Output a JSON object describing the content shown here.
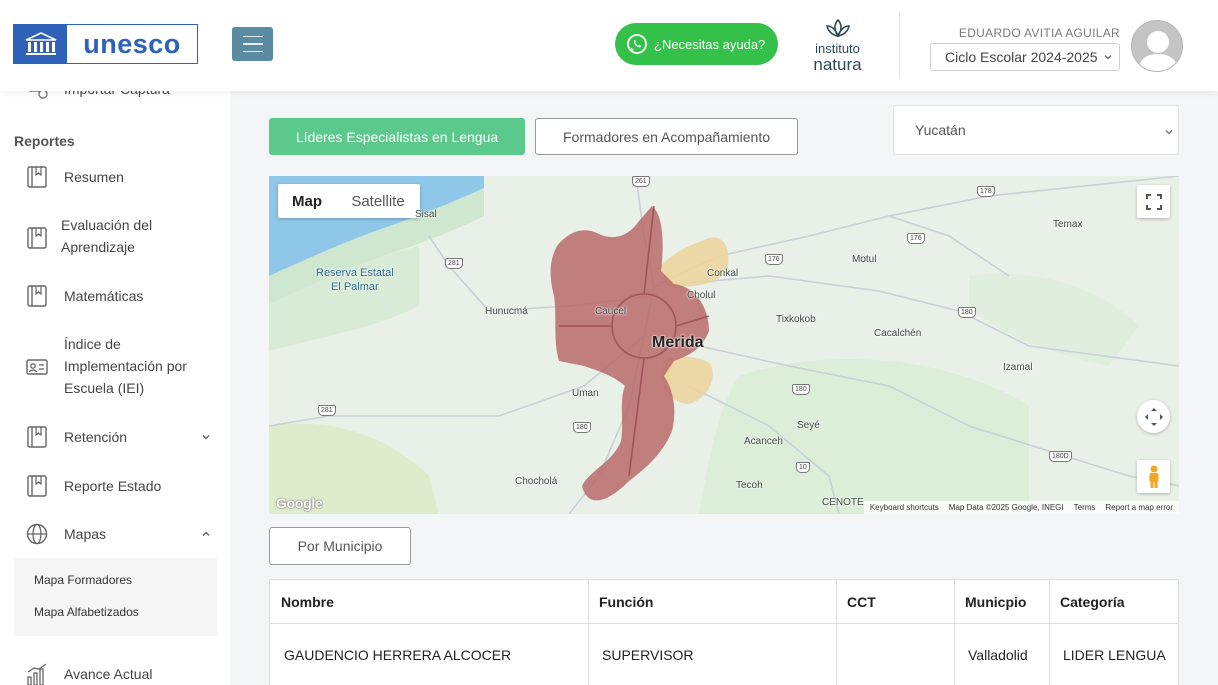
{
  "header": {
    "logo_text": "unesco",
    "help_label": "¿Necesitas ayuda?",
    "partner_line1": "instituto",
    "partner_line2": "natura",
    "user_name": "EDUARDO AVITIA AGUILAR",
    "cycle": "Ciclo Escolar 2024-2025"
  },
  "sidebar": {
    "top_partial": "Importar Captura",
    "section_reports": "Reportes",
    "items": [
      {
        "label": "Resumen"
      },
      {
        "label": "Evaluación del Aprendizaje"
      },
      {
        "label": "Matemáticas"
      },
      {
        "label": "Índice de Implementación por Escuela (IEI)"
      },
      {
        "label": "Retención"
      },
      {
        "label": "Reporte Estado"
      },
      {
        "label": "Mapas"
      },
      {
        "label": "Avance Actual"
      }
    ],
    "map_submenu": [
      "Mapa Formadores",
      "Mapa Alfabetizados"
    ]
  },
  "main": {
    "tab_active": "Líderes Especialistas en Lengua",
    "tab_inactive": "Formadores en Acompañamiento",
    "state": "Yucatán",
    "by_municipality": "Por Municipio"
  },
  "map": {
    "type_map": "Map",
    "type_satellite": "Satellite",
    "city": "Merida",
    "places": {
      "reserva": "Reserva Estatal",
      "palmar": "El Palmar",
      "sisal": "Sisal",
      "hunucma": "Hunucmá",
      "caucel": "Caucel",
      "conkal": "Conkal",
      "cholul": "Cholul",
      "motul": "Motul",
      "temax": "Temax",
      "tixkokob": "Tixkokob",
      "cacalchen": "Cacalchén",
      "izamal": "Izamal",
      "uman": "Uman",
      "seye": "Seyé",
      "acanceh": "Acanceh",
      "chochola": "Chocholá",
      "tecoh": "Tecoh",
      "cenote": "CENOTE"
    },
    "routes": [
      "261",
      "178",
      "176",
      "176",
      "281",
      "281",
      "180",
      "180",
      "180",
      "10",
      "180D"
    ],
    "attribution": {
      "shortcuts": "Keyboard shortcuts",
      "data": "Map Data ©2025 Google, INEGI",
      "terms": "Terms",
      "report": "Report a map error"
    },
    "google": "Google",
    "colors": {
      "dark_region": "#b86a6a",
      "light_region": "#ecd39a",
      "water": "#8fc7e8"
    }
  },
  "table": {
    "headers": [
      "Nombre",
      "Función",
      "CCT",
      "Municpio",
      "Categoría"
    ],
    "rows": [
      [
        "GAUDENCIO HERRERA ALCOCER",
        "SUPERVISOR",
        "",
        "Valladolid",
        "LIDER LENGUA"
      ]
    ]
  }
}
